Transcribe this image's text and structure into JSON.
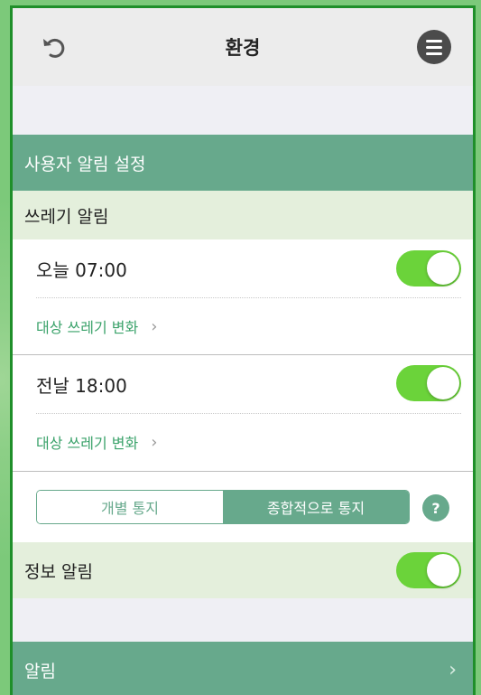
{
  "header": {
    "title": "환경",
    "undo_icon": "undo-icon",
    "menu_icon": "menu-icon"
  },
  "user_alert_section": {
    "title": "사용자 알림 설정"
  },
  "garbage_alert": {
    "title": "쓰레기 알림",
    "items": [
      {
        "time_label": "오늘 07:00",
        "enabled": true,
        "link_label": "대상 쓰레기 변화"
      },
      {
        "time_label": "전날 18:00",
        "enabled": true,
        "link_label": "대상 쓰레기 변화"
      }
    ]
  },
  "notify_mode": {
    "options": [
      "개별 통지",
      "종합적으로 통지"
    ],
    "selected": "종합적으로 통지",
    "help_label": "?"
  },
  "info_alert": {
    "label": "정보 알림",
    "enabled": true
  },
  "bottom": {
    "label": "알림"
  },
  "colors": {
    "accent_green": "#67a98c",
    "toggle_on": "#6bd33a",
    "link_text": "#3aa26a",
    "frame_border": "#1f8f2a"
  }
}
